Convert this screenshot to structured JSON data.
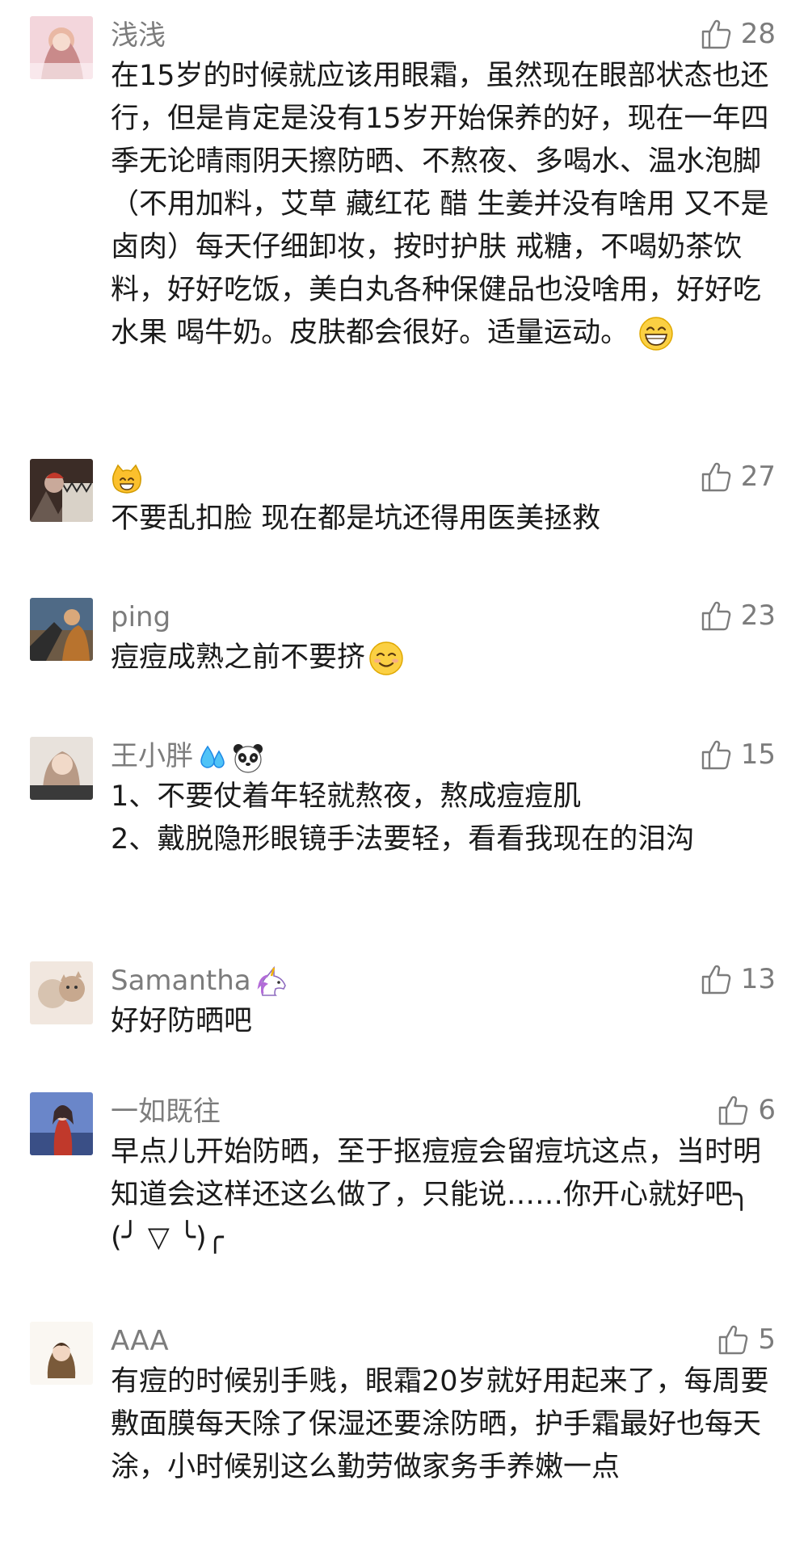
{
  "comments": [
    {
      "nickname": "浅浅",
      "likes": "28",
      "text": "在15岁的时候就应该用眼霜，虽然现在眼部状态也还行，但是肯定是没有15岁开始保养的好，现在一年四季无论晴雨阴天擦防晒、不熬夜、多喝水、温水泡脚（不用加料，艾草 藏红花 醋 生姜并没有啥用 又不是卤肉）每天仔细卸妆，按时护肤 戒糖，不喝奶茶饮料，好好吃饭，美白丸各种保健品也没啥用，好好吃水果 喝牛奶。皮肤都会很好。适量运动。",
      "trailing_emoji": "grinning-face"
    },
    {
      "nickname": "",
      "nickname_emoji": "cat-face",
      "likes": "27",
      "text": "不要乱扣脸 现在都是坑还得用医美拯救"
    },
    {
      "nickname": "ping",
      "likes": "23",
      "text": "痘痘成熟之前不要挤",
      "trailing_emoji": "smiling-face"
    },
    {
      "nickname": "王小胖",
      "nickname_emojis": [
        "sweat-droplets",
        "panda-face"
      ],
      "likes": "15",
      "text": "1、不要仗着年轻就熬夜，熬成痘痘肌\n2、戴脱隐形眼镜手法要轻，看看我现在的泪沟"
    },
    {
      "nickname": "Samantha",
      "nickname_emoji": "unicorn",
      "likes": "13",
      "text": "好好防晒吧"
    },
    {
      "nickname": "一如既往",
      "likes": "6",
      "text": "早点儿开始防晒，至于抠痘痘会留痘坑这点，当时明知道会这样还这么做了，只能说……你开心就好吧╮(╯ ▽ ╰)╭"
    },
    {
      "nickname": "AAA",
      "likes": "5",
      "text": "有痘的时候别手贱，眼霜20岁就好用起来了，每周要敷面膜每天除了保湿还要涂防晒，护手霜最好也每天涂，小时候别这么勤劳做家务手养嫩一点"
    }
  ],
  "icons": {
    "like": "thumbs-up-outline-icon"
  },
  "colors": {
    "meta_gray": "#7c7c7c",
    "text": "#1a1a1a",
    "background": "#ffffff"
  }
}
